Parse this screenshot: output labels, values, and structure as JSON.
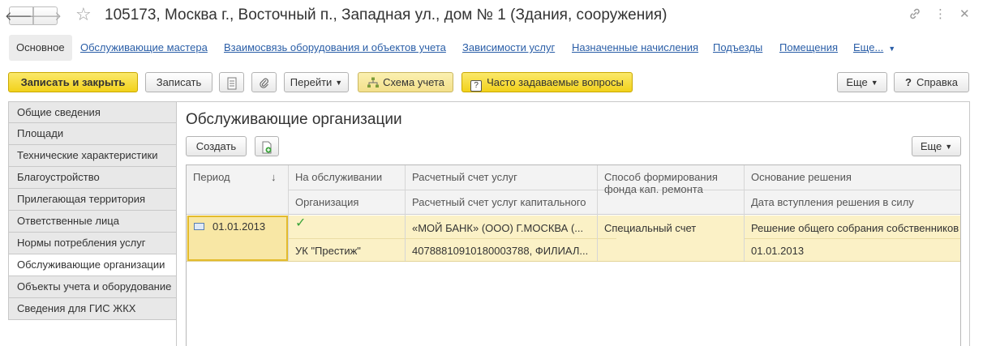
{
  "window": {
    "title": "105173, Москва г., Восточный п., Западная ул., дом № 1 (Здания, сооружения)",
    "icons": [
      "back-arrow-icon",
      "forward-arrow-icon",
      "star-icon",
      "link-icon",
      "more-vertical-icon",
      "close-icon"
    ]
  },
  "tabs": [
    {
      "label": "Основное",
      "active": true
    },
    {
      "label": "Обслуживающие мастера"
    },
    {
      "label": "Взаимосвязь оборудования и объектов учета"
    },
    {
      "label": "Зависимости услуг"
    },
    {
      "label": "Назначенные начисления"
    },
    {
      "label": "Подъезды"
    },
    {
      "label": "Помещения"
    },
    {
      "label": "Еще..."
    }
  ],
  "toolbar": {
    "save_close": "Записать и закрыть",
    "save": "Записать",
    "goto": "Перейти",
    "scheme": "Схема учета",
    "faq": "Часто задаваемые вопросы",
    "more": "Еще",
    "help": "Справка"
  },
  "leftnav": [
    {
      "label": "Общие сведения"
    },
    {
      "label": "Площади"
    },
    {
      "label": "Технические характеристики"
    },
    {
      "label": "Благоустройство"
    },
    {
      "label": "Прилегающая территория"
    },
    {
      "label": "Ответственные лица"
    },
    {
      "label": "Нормы потребления услуг"
    },
    {
      "label": "Обслуживающие организации",
      "active": true
    },
    {
      "label": "Объекты учета и оборудование"
    },
    {
      "label": "Сведения для ГИС ЖКХ"
    }
  ],
  "section": {
    "title": "Обслуживающие организации",
    "create": "Создать",
    "more": "Еще"
  },
  "table": {
    "headers": {
      "period": "Период",
      "sort_arrow": "↓",
      "on_service": "На обслуживании",
      "organization": "Организация",
      "account": "Расчетный счет услуг",
      "account_cap": "Расчетный счет услуг капитального",
      "fund_line1": "Способ формирования",
      "fund_line2": "фонда кап. ремонта",
      "basis": "Основание решения",
      "basis_date": "Дата вступления решения в силу"
    },
    "row": {
      "period": "01.01.2013",
      "on_service_mark": "✓",
      "organization": "УК \"Престиж\"",
      "account": "«МОЙ БАНК» (ООО) Г.МОСКВА (...",
      "account_cap": "40788810910180003788, ФИЛИАЛ...",
      "fund": "Специальный счет",
      "basis": "Решение общего собрания собственников",
      "basis_date": "01.01.2013"
    }
  },
  "colors": {
    "accent_yellow": "#f2d21b",
    "link_blue": "#2a5ea7",
    "selected_row": "#fbf1c6",
    "check_green": "#3aa43a"
  }
}
